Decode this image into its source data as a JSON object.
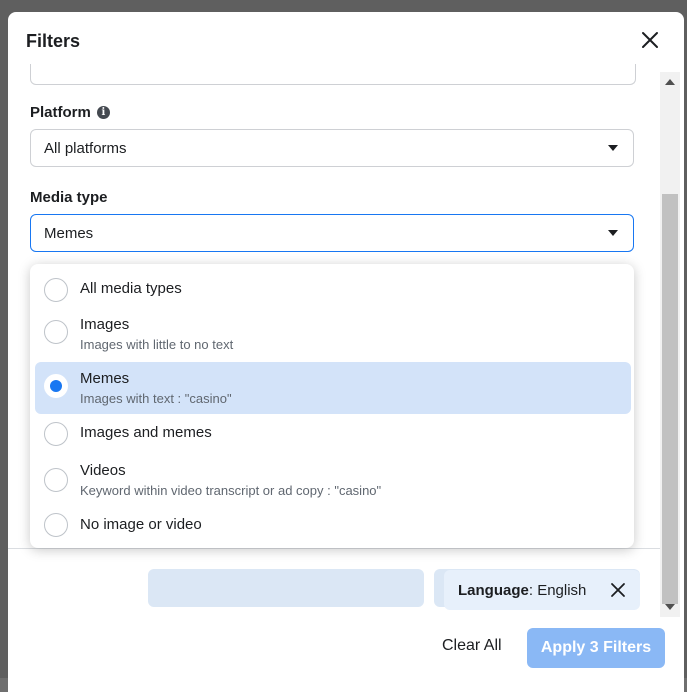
{
  "modal": {
    "title": "Filters"
  },
  "platform": {
    "label": "Platform",
    "value": "All platforms"
  },
  "media_type": {
    "label": "Media type",
    "value": "Memes",
    "options": [
      {
        "title": "All media types",
        "subtitle": "",
        "selected": false
      },
      {
        "title": "Images",
        "subtitle": "Images with little to no text",
        "selected": false
      },
      {
        "title": "Memes",
        "subtitle": "Images with text : \"casino\"",
        "selected": true
      },
      {
        "title": "Images and memes",
        "subtitle": "",
        "selected": false
      },
      {
        "title": "Videos",
        "subtitle": "Keyword within video transcript or ad copy : \"casino\"",
        "selected": false
      },
      {
        "title": "No image or video",
        "subtitle": "",
        "selected": false
      }
    ]
  },
  "language_chip": {
    "key": "Language",
    "separator": ": ",
    "value": "English"
  },
  "footer": {
    "clear_all": "Clear All",
    "apply": "Apply 3 Filters"
  },
  "colors": {
    "accent": "#1877f2",
    "selected_bg": "#d3e3f9",
    "apply_disabled": "#8ab8f5",
    "chip_bg": "#e7f0fb"
  }
}
